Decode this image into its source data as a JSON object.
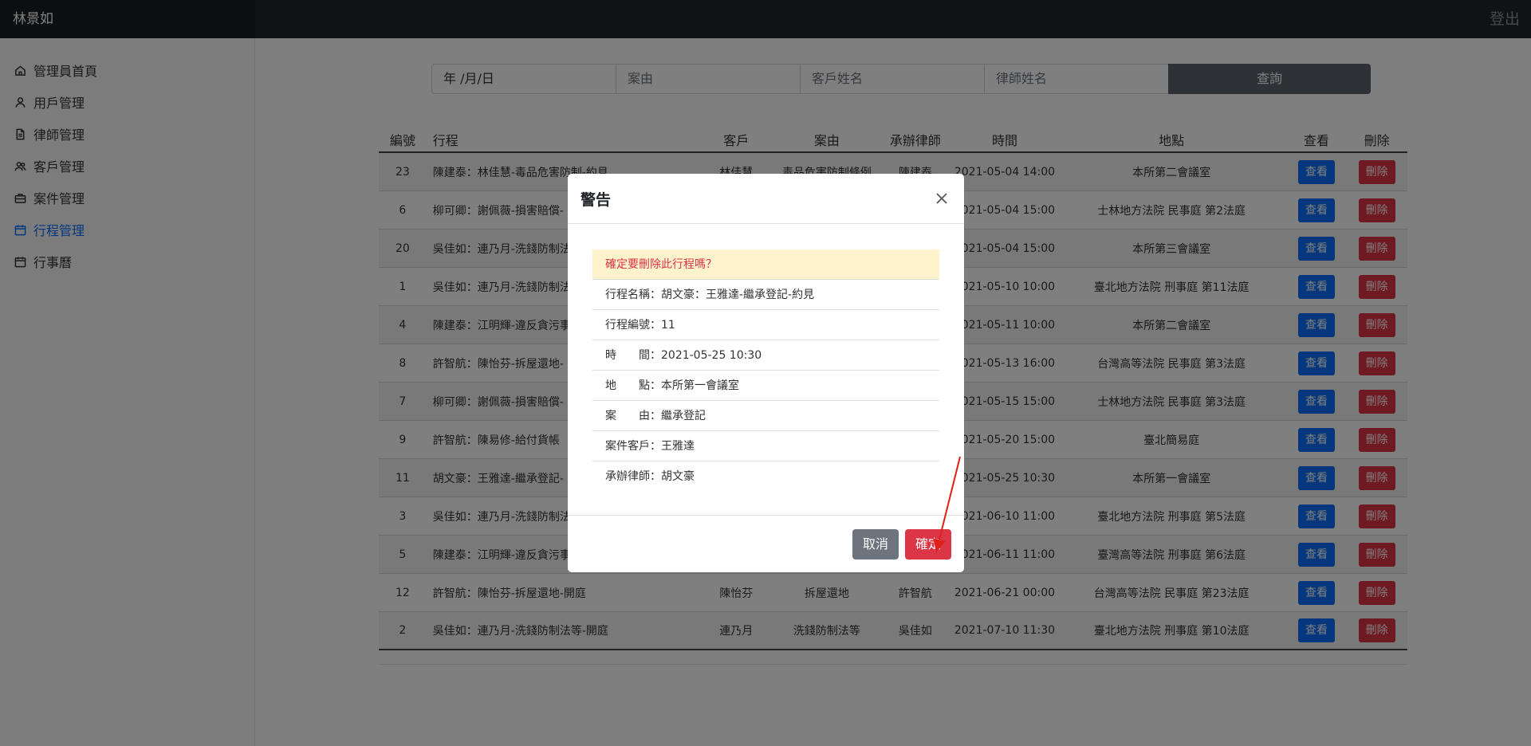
{
  "header": {
    "user_name": "林景如",
    "logout_label": "登出"
  },
  "sidebar": {
    "items": [
      {
        "label": "管理員首頁",
        "icon": "home-icon",
        "active": false
      },
      {
        "label": "用戶管理",
        "icon": "user-icon",
        "active": false
      },
      {
        "label": "律師管理",
        "icon": "document-icon",
        "active": false
      },
      {
        "label": "客戶管理",
        "icon": "users-icon",
        "active": false
      },
      {
        "label": "案件管理",
        "icon": "briefcase-icon",
        "active": false
      },
      {
        "label": "行程管理",
        "icon": "calendar-icon",
        "active": true
      },
      {
        "label": "行事曆",
        "icon": "calendar-icon",
        "active": false
      }
    ]
  },
  "search": {
    "date_placeholder": "年 /月/日",
    "case_placeholder": "案由",
    "client_placeholder": "客戶姓名",
    "lawyer_placeholder": "律師姓名",
    "query_label": "查詢"
  },
  "table": {
    "headers": [
      "編號",
      "行程",
      "客戶",
      "案由",
      "承辦律師",
      "時間",
      "地點",
      "查看",
      "刪除"
    ],
    "view_label": "查看",
    "delete_label": "刪除",
    "rows": [
      {
        "id": "23",
        "name": "陳建泰：林佳慧-毒品危害防制-約見",
        "client": "林佳慧",
        "case": "毒品危害防制條例",
        "lawyer": "陳建泰",
        "time": "2021-05-04 14:00",
        "place": "本所第二會議室"
      },
      {
        "id": "6",
        "name": "柳可卿：謝佩薇-損害賠償-",
        "client": "",
        "case": "",
        "lawyer": "",
        "time": "2021-05-04 15:00",
        "place": "士林地方法院 民事庭 第2法庭"
      },
      {
        "id": "20",
        "name": "吳佳如：連乃月-洗錢防制法",
        "client": "",
        "case": "",
        "lawyer": "",
        "time": "2021-05-04 15:00",
        "place": "本所第三會議室"
      },
      {
        "id": "1",
        "name": "吳佳如：連乃月-洗錢防制法",
        "client": "",
        "case": "",
        "lawyer": "",
        "time": "2021-05-10 10:00",
        "place": "臺北地方法院 刑事庭 第11法庭"
      },
      {
        "id": "4",
        "name": "陳建泰：江明輝-違反貪污事",
        "client": "",
        "case": "",
        "lawyer": "",
        "time": "2021-05-11 10:00",
        "place": "本所第二會議室"
      },
      {
        "id": "8",
        "name": "許智航：陳怡芬-拆屋還地-",
        "client": "",
        "case": "",
        "lawyer": "",
        "time": "2021-05-13 16:00",
        "place": "台灣高等法院 民事庭 第3法庭"
      },
      {
        "id": "7",
        "name": "柳可卿：謝佩薇-損害賠償-",
        "client": "",
        "case": "",
        "lawyer": "",
        "time": "2021-05-15 15:00",
        "place": "士林地方法院 民事庭 第3法庭"
      },
      {
        "id": "9",
        "name": "許智航：陳易修-給付貨帳",
        "client": "",
        "case": "",
        "lawyer": "",
        "time": "2021-05-20 15:00",
        "place": "臺北簡易庭"
      },
      {
        "id": "11",
        "name": "胡文豪：王雅達-繼承登記-",
        "client": "",
        "case": "",
        "lawyer": "",
        "time": "2021-05-25 10:30",
        "place": "本所第一會議室"
      },
      {
        "id": "3",
        "name": "吳佳如：連乃月-洗錢防制法",
        "client": "",
        "case": "",
        "lawyer": "",
        "time": "2021-06-10 11:00",
        "place": "臺北地方法院 刑事庭 第5法庭"
      },
      {
        "id": "5",
        "name": "陳建泰：江明輝-違反貪污事",
        "client": "",
        "case": "",
        "lawyer": "",
        "time": "2021-06-11 11:00",
        "place": "臺灣高等法院 刑事庭 第6法庭"
      },
      {
        "id": "12",
        "name": "許智航：陳怡芬-拆屋還地-開庭",
        "client": "陳怡芬",
        "case": "拆屋還地",
        "lawyer": "許智航",
        "time": "2021-06-21 00:00",
        "place": "台灣高等法院 民事庭 第23法庭"
      },
      {
        "id": "2",
        "name": "吳佳如：連乃月-洗錢防制法等-開庭",
        "client": "連乃月",
        "case": "洗錢防制法等",
        "lawyer": "吳佳如",
        "time": "2021-07-10 11:30",
        "place": "臺北地方法院 刑事庭 第10法庭"
      }
    ]
  },
  "modal": {
    "title": "警告",
    "confirm_message": "確定要刪除此行程嗎？",
    "details": [
      "行程名稱：胡文豪：王雅達-繼承登記-約見",
      "行程編號：11",
      "時　　間：2021-05-25 10:30",
      "地　　點：本所第一會議室",
      "案　　由：繼承登記",
      "案件客戶：王雅達",
      "承辦律師：胡文豪"
    ],
    "cancel_label": "取消",
    "confirm_label": "確定"
  },
  "colors": {
    "primary": "#0d6efd",
    "danger": "#dc3545",
    "secondary": "#6c757d",
    "warning_bg": "#fff3cd",
    "topbar": "#212529"
  }
}
